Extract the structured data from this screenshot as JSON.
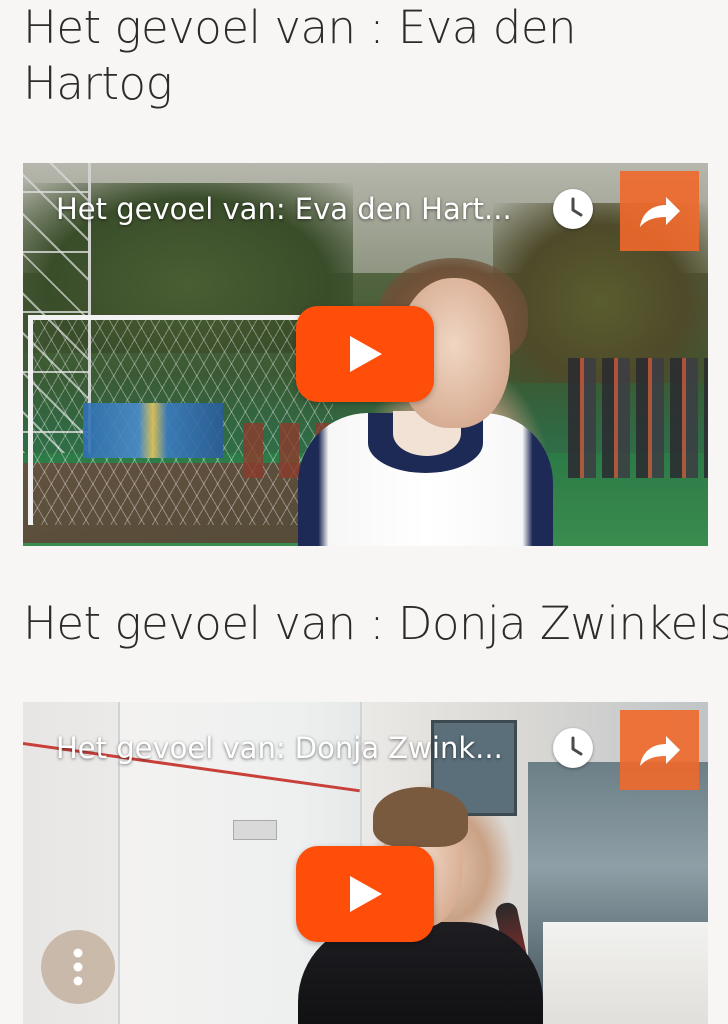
{
  "sections": [
    {
      "heading": "Het gevoel van : Eva den Hartog",
      "video": {
        "title": "Het gevoel van: Eva den Hart...",
        "watch_later_icon": "clock-icon",
        "share_icon": "share-arrow-icon",
        "play_icon": "youtube-play-icon",
        "player_brand_color": "#ff4d0a",
        "share_bg_color": "#ef682a"
      }
    },
    {
      "heading": "Het gevoel van : Donja Zwinkels",
      "video": {
        "title": "Het gevoel van: Donja Zwink...",
        "watch_later_icon": "clock-icon",
        "share_icon": "share-arrow-icon",
        "play_icon": "youtube-play-icon",
        "player_brand_color": "#ff4d0a",
        "share_bg_color": "#ef682a"
      }
    }
  ],
  "floating_menu": {
    "icon": "more-vertical-icon"
  }
}
